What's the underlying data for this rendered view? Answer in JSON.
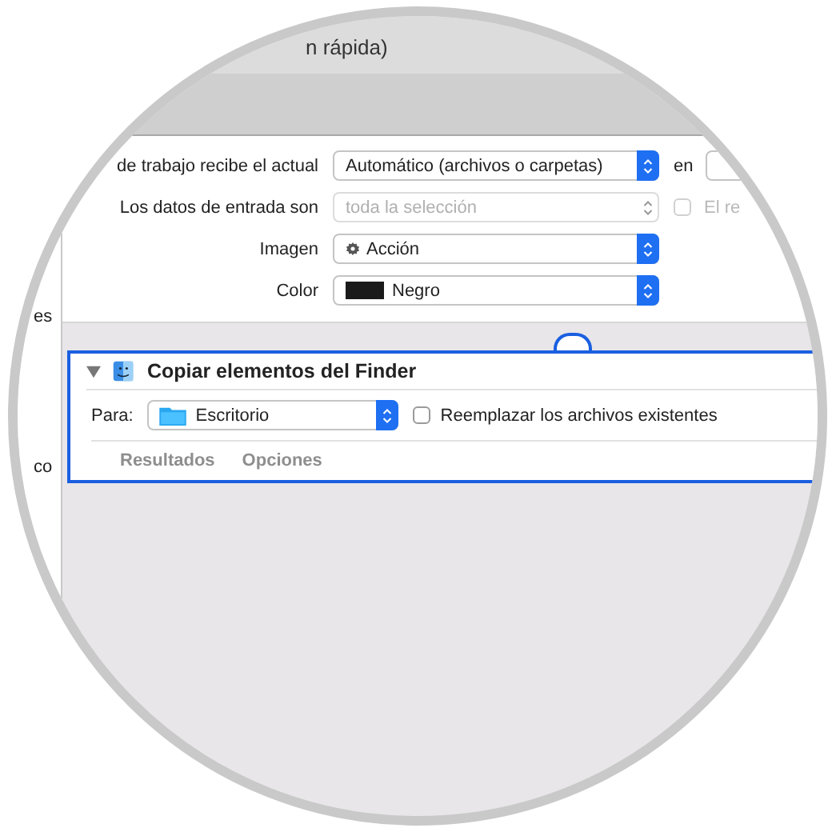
{
  "window": {
    "title": "n rápida)"
  },
  "sidebar": {
    "items": [
      "es",
      "co"
    ]
  },
  "settings": {
    "rows": [
      {
        "label": "de trabajo recibe el actual",
        "kind": "popup",
        "value": "Automático (archivos o carpetas)",
        "disabled": false,
        "after": {
          "kind": "label-field",
          "label": "en"
        }
      },
      {
        "label": "Los datos de entrada son",
        "kind": "popup",
        "value": "toda la selección",
        "disabled": true,
        "after": {
          "kind": "checkbox",
          "label": "El re",
          "checked": false,
          "disabled": true
        }
      },
      {
        "label": "Imagen",
        "kind": "icon-popup",
        "value": "Acción",
        "disabled": false
      },
      {
        "label": "Color",
        "kind": "swatch-popup",
        "value": "Negro",
        "disabled": false,
        "color": "#1a1a1a"
      }
    ]
  },
  "action": {
    "title": "Copiar elementos del Finder",
    "expanded": true,
    "target_label": "Para:",
    "target": "Escritorio",
    "replace": {
      "label": "Reemplazar los archivos existentes",
      "checked": false
    },
    "tabs": [
      {
        "label": "Resultados",
        "selected": false
      },
      {
        "label": "Opciones",
        "selected": false
      }
    ]
  }
}
